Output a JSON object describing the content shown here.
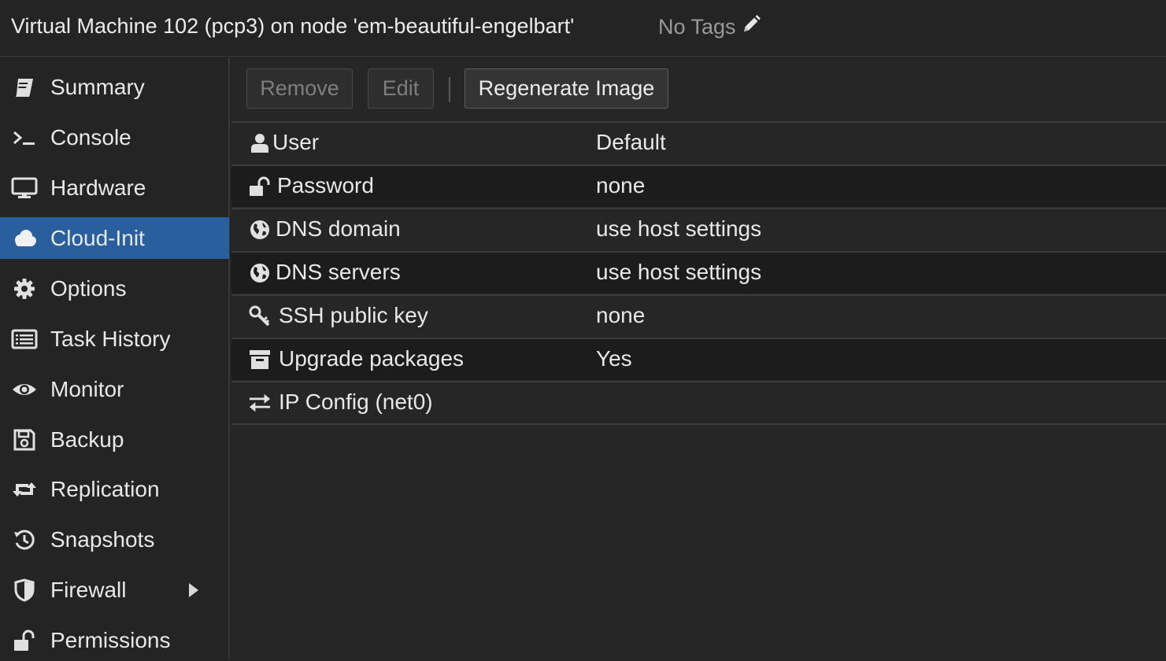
{
  "header": {
    "title": "Virtual Machine 102 (pcp3) on node 'em-beautiful-engelbart'",
    "tags": "No Tags",
    "tags_edit_icon": "pencil-icon"
  },
  "sidebar": {
    "items": [
      {
        "label": "Summary",
        "icon": "book-icon"
      },
      {
        "label": "Console",
        "icon": "terminal-icon"
      },
      {
        "label": "Hardware",
        "icon": "monitor-icon"
      },
      {
        "label": "Cloud-Init",
        "icon": "cloud-icon",
        "active": true
      },
      {
        "label": "Options",
        "icon": "gear-icon"
      },
      {
        "label": "Task History",
        "icon": "list-icon"
      },
      {
        "label": "Monitor",
        "icon": "eye-icon"
      },
      {
        "label": "Backup",
        "icon": "floppy-icon"
      },
      {
        "label": "Replication",
        "icon": "retweet-icon"
      },
      {
        "label": "Snapshots",
        "icon": "history-icon"
      },
      {
        "label": "Firewall",
        "icon": "shield-icon",
        "expandable": true
      },
      {
        "label": "Permissions",
        "icon": "unlock-icon"
      }
    ]
  },
  "toolbar": {
    "remove_label": "Remove",
    "edit_label": "Edit",
    "regenerate_label": "Regenerate Image"
  },
  "cloudinit": {
    "rows": [
      {
        "key": "User",
        "value": "Default",
        "icon": "user-icon"
      },
      {
        "key": "Password",
        "value": "none",
        "icon": "unlock-icon"
      },
      {
        "key": "DNS domain",
        "value": "use host settings",
        "icon": "globe-icon"
      },
      {
        "key": "DNS servers",
        "value": "use host settings",
        "icon": "globe-icon"
      },
      {
        "key": "SSH public key",
        "value": "none",
        "icon": "key-icon"
      },
      {
        "key": "Upgrade packages",
        "value": "Yes",
        "icon": "archive-icon"
      },
      {
        "key": "IP Config (net0)",
        "value": "",
        "icon": "exchange-icon"
      }
    ]
  },
  "colors": {
    "accent": "#2a5f9e",
    "background": "#242424"
  }
}
